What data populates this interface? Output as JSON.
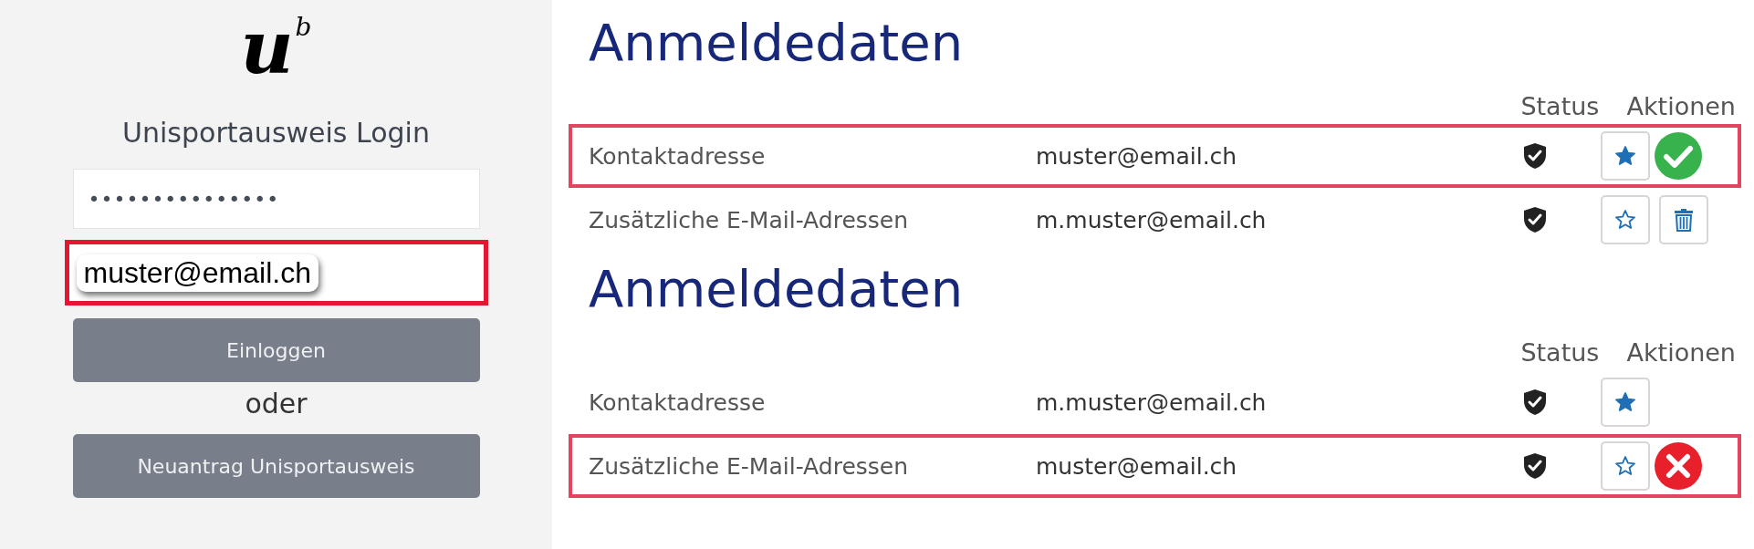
{
  "login": {
    "logo": {
      "letter": "u",
      "superscript": "b"
    },
    "title": "Unisportausweis Login",
    "fields": [
      {
        "kind": "password",
        "value": "•••••••••••••••",
        "highlighted": false
      },
      {
        "kind": "email",
        "value": "muster@email.ch",
        "highlighted": true
      }
    ],
    "login_button": "Einloggen",
    "separator": "oder",
    "apply_button": "Neuantrag Unisportausweis"
  },
  "sections": [
    {
      "title": "Anmeldedaten",
      "columns": [
        "Status",
        "Aktionen"
      ],
      "rows": [
        {
          "label": "Kontaktadresse",
          "email": "muster@email.ch",
          "highlighted": true,
          "starred": true,
          "kind": "success"
        },
        {
          "label": "Zusätzliche E-Mail-Adressen",
          "email": "m.muster@email.ch",
          "highlighted": false,
          "starred": false,
          "kind": "delete"
        }
      ]
    },
    {
      "title": "Anmeldedaten",
      "columns": [
        "Status",
        "Aktionen"
      ],
      "rows": [
        {
          "label": "Kontaktadresse",
          "email": "m.muster@email.ch",
          "highlighted": false,
          "starred": true,
          "kind": "plain"
        },
        {
          "label": "Zusätzliche E-Mail-Adressen",
          "email": "muster@email.ch",
          "highlighted": true,
          "starred": false,
          "kind": "error"
        }
      ]
    }
  ]
}
